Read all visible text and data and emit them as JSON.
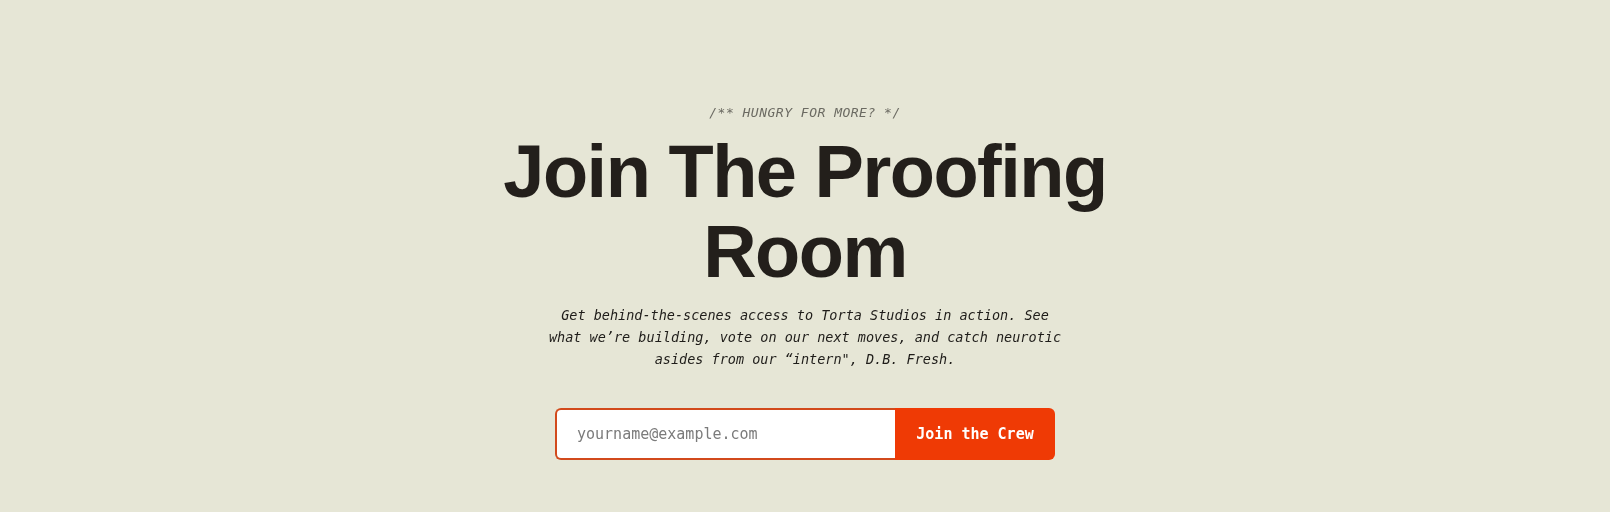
{
  "eyebrow": "/** HUNGRY FOR MORE? */",
  "heading": "Join The Proofing Room",
  "description": "Get behind-the-scenes access to Torta Studios in action. See what we’re building, vote on our next moves, and catch neurotic asides from our “intern\", D.B. Fresh.",
  "signup": {
    "email": {
      "placeholder": "yourname@example.com"
    },
    "button": "Join the Crew"
  }
}
